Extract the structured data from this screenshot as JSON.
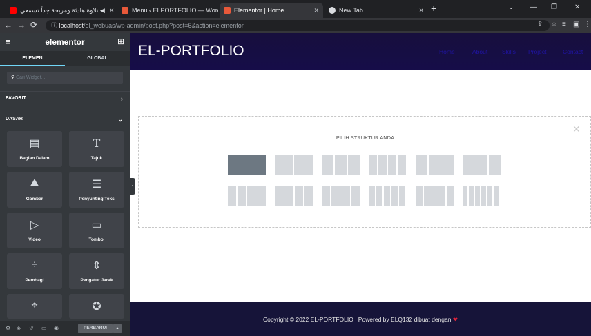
{
  "browser": {
    "tabs": [
      {
        "title": "تلاوة هادئة ومريحة جداً تسمعي ◀",
        "icon": "youtube-icon",
        "color": "#ff0000",
        "active": false
      },
      {
        "title": "Menu ‹ ELPORTFOLIO — WordPr",
        "icon": "elementor-icon",
        "color": "#e8593a",
        "active": false
      },
      {
        "title": "Elementor | Home",
        "icon": "elementor-icon",
        "color": "#e8593a",
        "active": true
      },
      {
        "title": "New Tab",
        "icon": "chrome-icon",
        "color": "#dadce0",
        "active": false
      }
    ],
    "url_host": "localhost",
    "url_path": "/el_webuas/wp-admin/post.php?post=6&action=elementor"
  },
  "panel": {
    "logo": "elementor",
    "tabs": [
      "ELEMEN",
      "GLOBAL"
    ],
    "search_placeholder": "Cari Widget...",
    "sections": {
      "favorites": "FAVORIT",
      "basic": "DASAR"
    },
    "widgets": [
      {
        "label": "Bagian Dalam",
        "icon": "inner-section-icon"
      },
      {
        "label": "Tajuk",
        "icon": "heading-icon"
      },
      {
        "label": "Gambar",
        "icon": "image-icon"
      },
      {
        "label": "Penyunting Teks",
        "icon": "text-editor-icon"
      },
      {
        "label": "Video",
        "icon": "video-icon"
      },
      {
        "label": "Tombol",
        "icon": "button-icon"
      },
      {
        "label": "Pembagi",
        "icon": "divider-icon"
      },
      {
        "label": "Pengatur Jarak",
        "icon": "spacer-icon"
      },
      {
        "label": "",
        "icon": "google-maps-icon"
      },
      {
        "label": "",
        "icon": "star-icon"
      }
    ],
    "update_button": "PERBARUI"
  },
  "site": {
    "title": "EL-PORTFOLIO",
    "nav": [
      "Home",
      "About",
      "Skills",
      "Project",
      "Contact"
    ],
    "structure_title": "PILIH STRUKTUR ANDA",
    "footer_text": "Copyright © 2022 EL-PORTFOLIO | Powered by ELQ132 dibuat dengan",
    "colors": {
      "header": "#170f3d",
      "nav_link": "#1f14a4",
      "footer": "#161439",
      "accent": "#71d7f7"
    }
  }
}
